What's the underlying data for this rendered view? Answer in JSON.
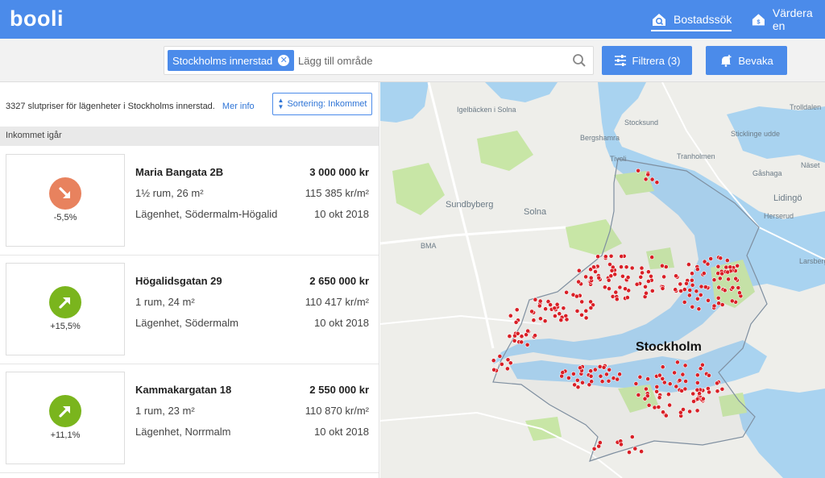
{
  "header": {
    "logo": "booli",
    "nav": [
      {
        "label": "Bostadssök",
        "icon": "home-search-icon"
      },
      {
        "label": "Värdera en",
        "icon": "home-value-icon"
      }
    ]
  },
  "search": {
    "chip_label": "Stockholms innerstad",
    "placeholder": "Lägg till område",
    "filter_label": "Filtrera (3)",
    "watch_label": "Bevaka"
  },
  "results": {
    "summary": "3327 slutpriser för lägenheter i Stockholms innerstad.",
    "more_info": "Mer info",
    "sort_label": "Sortering: Inkommet",
    "section_title": "Inkommet igår",
    "listings": [
      {
        "address": "Maria Bangata 2B",
        "price": "3 000 000 kr",
        "rooms": "1½ rum, 26 m²",
        "price_per_sqm": "115 385 kr/m²",
        "type": "Lägenhet, Södermalm-Högalid",
        "date": "10 okt 2018",
        "change": "-5,5%",
        "trend": "down",
        "color": "#e8825e"
      },
      {
        "address": "Högalidsgatan 29",
        "price": "2 650 000 kr",
        "rooms": "1 rum, 24 m²",
        "price_per_sqm": "110 417 kr/m²",
        "type": "Lägenhet, Södermalm",
        "date": "10 okt 2018",
        "change": "+15,5%",
        "trend": "up",
        "color": "#7ab51d"
      },
      {
        "address": "Kammakargatan 18",
        "price": "2 550 000 kr",
        "rooms": "1 rum, 23 m²",
        "price_per_sqm": "110 870 kr/m²",
        "type": "Lägenhet, Norrmalm",
        "date": "10 okt 2018",
        "change": "+11,1%",
        "trend": "up",
        "color": "#7ab51d"
      }
    ]
  },
  "map": {
    "labels": [
      "Igelbäcken i Solna",
      "Stocksund",
      "Bergshamra",
      "Tivoli",
      "Tranholmen",
      "Sticklinge udde",
      "Näset",
      "Gåshaga",
      "Trolldalen",
      "Sundbyberg",
      "Solna",
      "Lidingö",
      "Herserud",
      "BMA",
      "Larsberg",
      "Stockholm"
    ],
    "colors": {
      "water": "#a9d3f0",
      "land": "#eeeeea",
      "park": "#c8e6a6",
      "dot": "#d91f26"
    }
  }
}
